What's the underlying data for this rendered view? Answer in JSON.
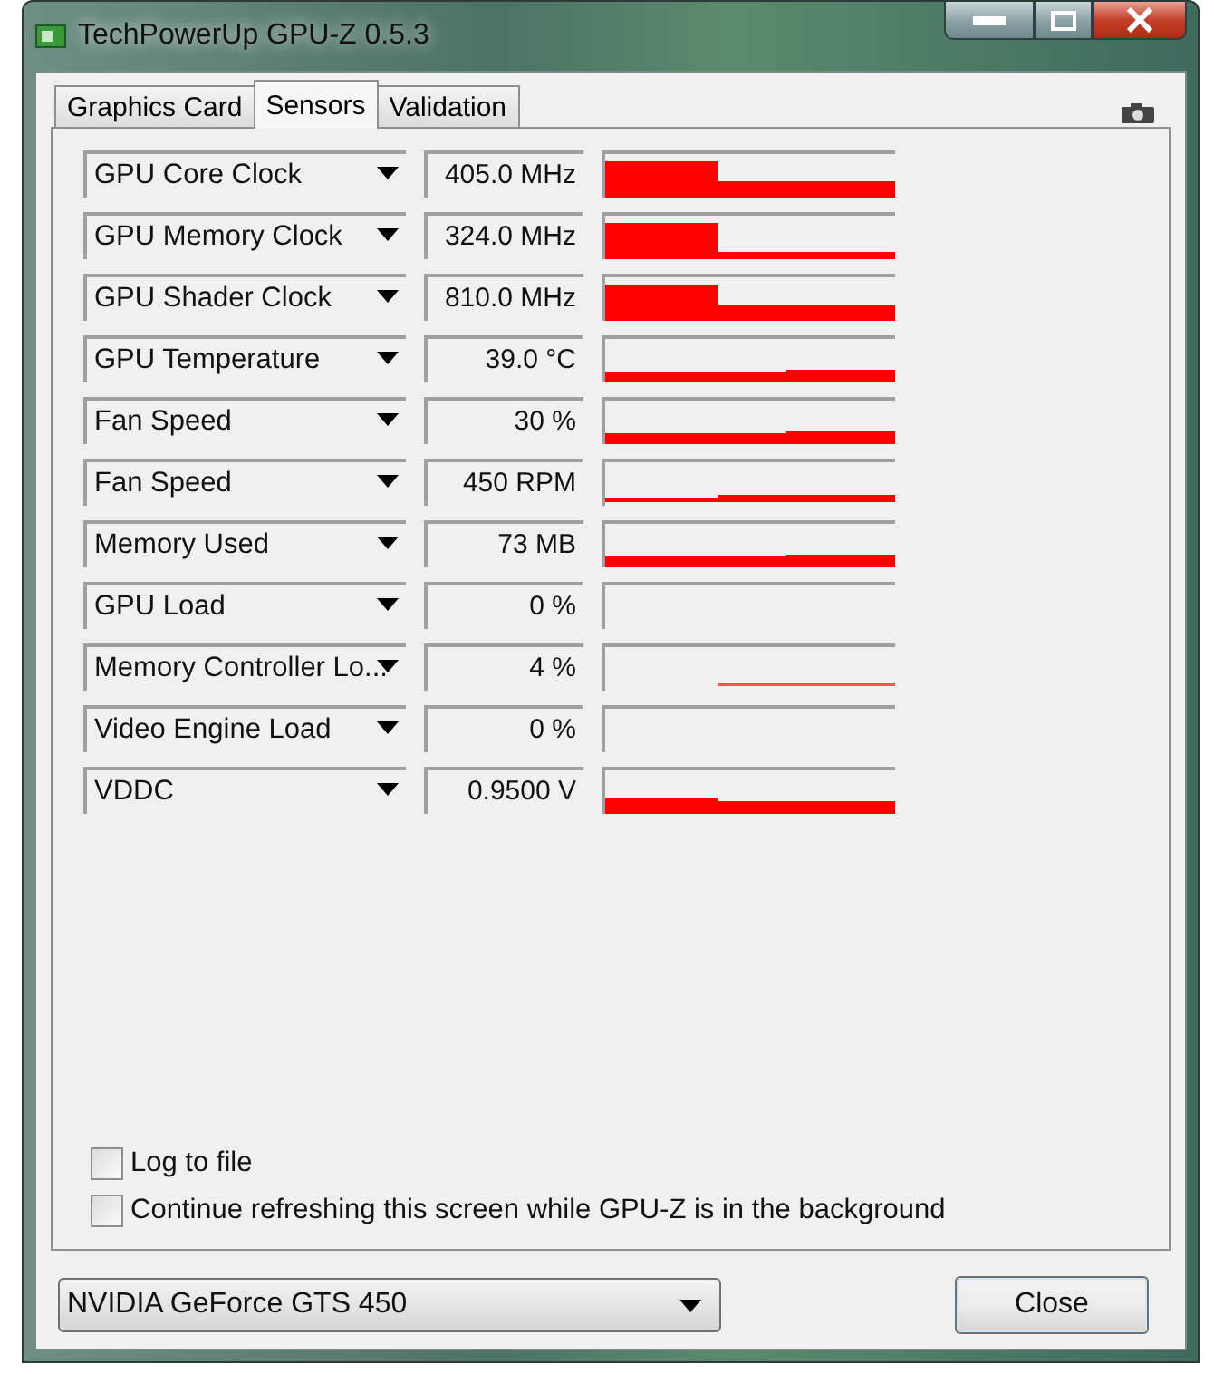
{
  "window": {
    "title": "TechPowerUp GPU-Z 0.5.3"
  },
  "tabs": [
    {
      "label": "Graphics Card",
      "selected": false
    },
    {
      "label": "Sensors",
      "selected": true
    },
    {
      "label": "Validation",
      "selected": false
    }
  ],
  "sensors": [
    {
      "name": "GPU Core Clock",
      "reading": "405.0 MHz",
      "graph": {
        "kind": "high-step-down"
      }
    },
    {
      "name": "GPU Memory Clock",
      "reading": "324.0 MHz",
      "graph": {
        "kind": "high-step-thin"
      }
    },
    {
      "name": "GPU Shader Clock",
      "reading": "810.0 MHz",
      "graph": {
        "kind": "high-step-down"
      }
    },
    {
      "name": "GPU Temperature",
      "reading": "39.0 °C",
      "graph": {
        "kind": "low-flat"
      }
    },
    {
      "name": "Fan Speed",
      "reading": "30 %",
      "graph": {
        "kind": "low-flat"
      }
    },
    {
      "name": "Fan Speed",
      "reading": "450 RPM",
      "graph": {
        "kind": "step-up"
      }
    },
    {
      "name": "Memory Used",
      "reading": "73 MB",
      "graph": {
        "kind": "low-flat"
      }
    },
    {
      "name": "GPU Load",
      "reading": "0 %",
      "graph": {
        "kind": "empty"
      }
    },
    {
      "name": "Memory Controller Lo...",
      "reading": "4 %",
      "graph": {
        "kind": "faint-step"
      }
    },
    {
      "name": "Video Engine Load",
      "reading": "0 %",
      "graph": {
        "kind": "empty"
      }
    },
    {
      "name": "VDDC",
      "reading": "0.9500 V",
      "graph": {
        "kind": "thick-flat"
      }
    }
  ],
  "options": [
    {
      "label": "Log to file",
      "checked": false
    },
    {
      "label": "Continue refreshing this screen while GPU-Z is in the background",
      "checked": false
    }
  ],
  "card_select": {
    "value": "NVIDIA GeForce GTS 450"
  },
  "close_button": {
    "label": "Close"
  }
}
